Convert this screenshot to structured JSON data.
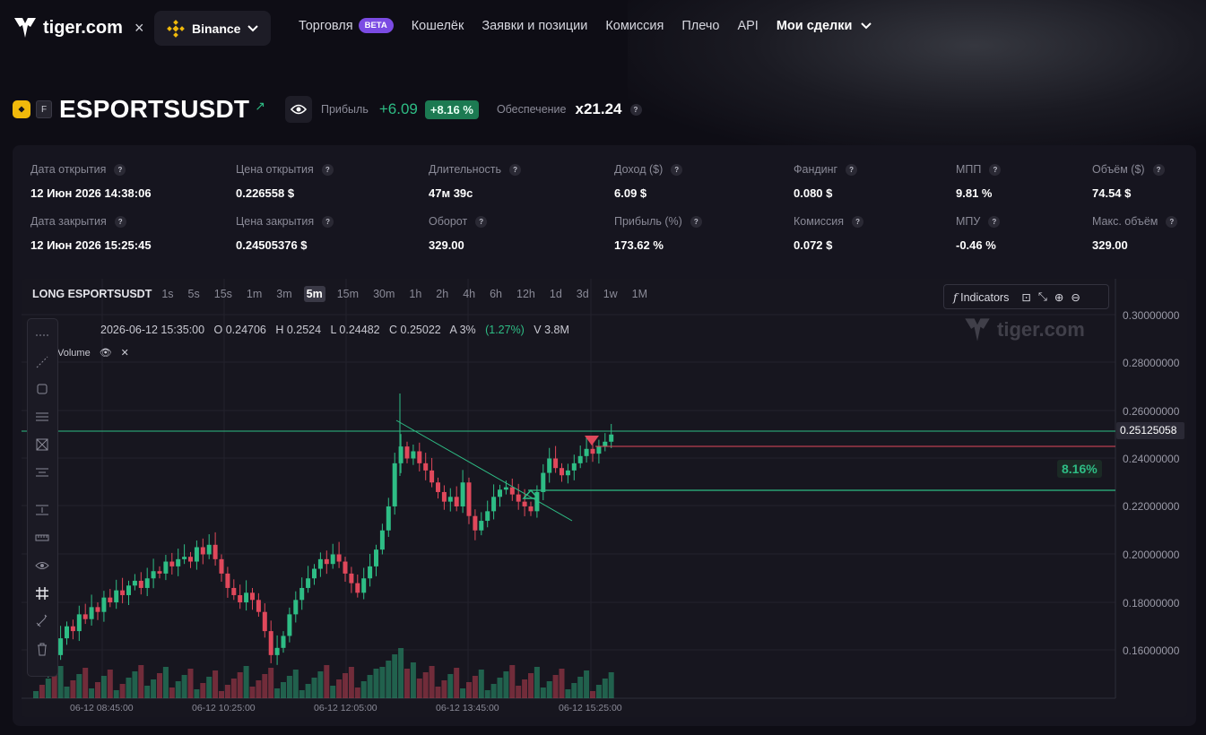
{
  "brand": {
    "name": "tiger.com",
    "times": "×",
    "exchange": "Binance"
  },
  "nav": {
    "items": [
      "Торговля",
      "Кошелёк",
      "Заявки и позиции",
      "Комиссия",
      "Плечо",
      "API"
    ],
    "beta": "BETA",
    "my_trades": "Мои сделки"
  },
  "ticker": {
    "symbol": "ESPORTSUSDT",
    "f_badge": "F",
    "profit_label": "Прибыль",
    "profit_value": "+6.09",
    "profit_pct": "+8.16 %",
    "collateral_label": "Обеспечение",
    "collateral_value": "x21.24"
  },
  "stats": [
    {
      "k": "Дата открытия",
      "v": "12 Июн 2026 14:38:06"
    },
    {
      "k": "Цена открытия",
      "v": "0.226558 $"
    },
    {
      "k": "Длительность",
      "v": "47м 39с"
    },
    {
      "k": "Доход ($)",
      "v": "6.09 $"
    },
    {
      "k": "Фандинг",
      "v": "0.080 $"
    },
    {
      "k": "МПП",
      "v": "9.81 %"
    },
    {
      "k": "Объём ($)",
      "v": "74.54 $"
    },
    {
      "k": "Дата закрытия",
      "v": "12 Июн 2026 15:25:45"
    },
    {
      "k": "Цена закрытия",
      "v": "0.24505376 $"
    },
    {
      "k": "Оборот",
      "v": "329.00"
    },
    {
      "k": "Прибыль (%)",
      "v": "173.62 %"
    },
    {
      "k": "Комиссия",
      "v": "0.072 $"
    },
    {
      "k": "МПУ",
      "v": "-0.46 %"
    },
    {
      "k": "Макс. объём",
      "v": "329.00"
    }
  ],
  "chart": {
    "title": "LONG ESPORTSUSDT",
    "timeframes": [
      "1s",
      "5s",
      "15s",
      "1m",
      "3m",
      "5m",
      "15m",
      "30m",
      "1h",
      "2h",
      "4h",
      "6h",
      "12h",
      "1d",
      "3d",
      "1w",
      "1M"
    ],
    "active_tf": "5m",
    "indicators_label": "Indicators",
    "ohlc": {
      "time": "2026-06-12 15:35:00",
      "o": "O 0.24706",
      "h": "H 0.2524",
      "l": "L 0.24482",
      "c": "C 0.25022",
      "a": "A 3%",
      "pct": "(1.27%)",
      "v": "V 3.8M"
    },
    "volume_label": "Volume",
    "price_labels": [
      "0.30000000",
      "0.28000000",
      "0.26000000",
      "0.24000000",
      "0.22000000",
      "0.20000000",
      "0.18000000",
      "0.16000000"
    ],
    "current_price": "0.25125058",
    "pnl_tag": "8.16%",
    "time_labels": [
      "06-12 08:45:00",
      "06-12 10:25:00",
      "06-12 12:05:00",
      "06-12 13:45:00",
      "06-12 15:25:00"
    ],
    "watermark": "tiger.com",
    "colors": {
      "up": "#2ebd85",
      "down": "#e0485b",
      "bg": "#17161f"
    }
  }
}
